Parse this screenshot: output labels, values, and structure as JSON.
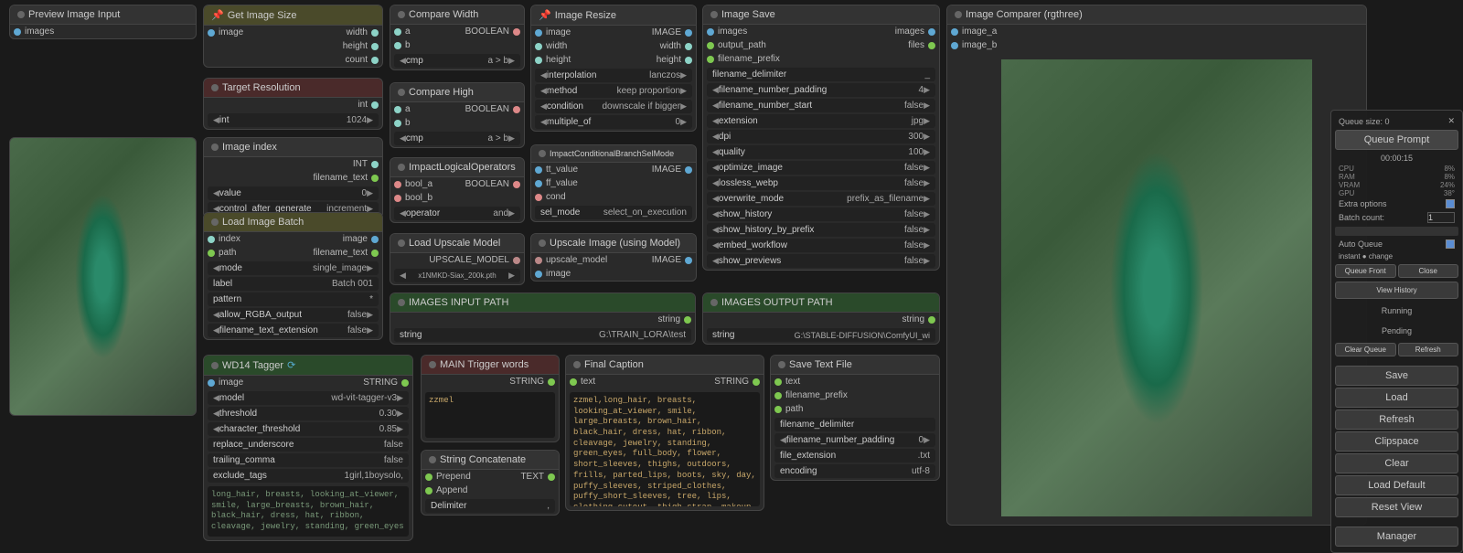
{
  "nodes": {
    "preview_input": {
      "title": "Preview Image Input",
      "outputs": [
        "images"
      ]
    },
    "get_size": {
      "title": "Get Image Size",
      "inputs": [
        "image"
      ],
      "outputs": [
        "width",
        "height",
        "count"
      ]
    },
    "target_res": {
      "title": "Target Resolution",
      "outputs": [
        "int"
      ],
      "int_val": "1024"
    },
    "image_index": {
      "title": "Image index",
      "outputs": [
        "INT",
        "filename_text"
      ],
      "value": "0",
      "ctrl": "increment"
    },
    "load_batch": {
      "title": "Load Image Batch",
      "out_image": "image",
      "out_ft": "filename_text",
      "in_index": "index",
      "in_path": "path",
      "mode": "single_image",
      "label": "Batch 001",
      "pattern": "*",
      "rgba": "false",
      "fte": "false"
    },
    "wd14": {
      "title": "WD14 Tagger",
      "in_image": "image",
      "out_str": "STRING",
      "model": "wd-vit-tagger-v3",
      "thresh": "0.30",
      "char": "0.85",
      "ru": "false",
      "tc": "false",
      "et": "1girl,1boysolo,",
      "caption": "long_hair, breasts, looking_at_viewer, smile, large_breasts, brown_hair, black_hair, dress, hat, ribbon, cleavage, jewelry, standing, green_eyes"
    },
    "compare_w": {
      "title": "Compare Width",
      "a": "a",
      "b": "b",
      "out": "BOOLEAN",
      "cmp": "a > b"
    },
    "compare_h": {
      "title": "Compare High",
      "a": "a",
      "b": "b",
      "out": "BOOLEAN",
      "cmp": "a > b"
    },
    "logic": {
      "title": "ImpactLogicalOperators",
      "a": "bool_a",
      "b": "bool_b",
      "out": "BOOLEAN",
      "op": "and"
    },
    "load_upscale": {
      "title": "Load Upscale Model",
      "out": "UPSCALE_MODEL",
      "model": "x1NMKD-Siax_200k.pth"
    },
    "images_input": {
      "title": "IMAGES INPUT PATH",
      "out": "string",
      "val": "G:\\TRAIN_LORA\\test"
    },
    "main_trigger": {
      "title": "MAIN Trigger words",
      "out": "STRING",
      "val": "zzmel"
    },
    "str_concat": {
      "title": "String Concatenate",
      "in1": "Prepend",
      "in2": "Append",
      "out": "TEXT",
      "delim": ","
    },
    "resize": {
      "title": "Image Resize",
      "in_image": "image",
      "in_width": "width",
      "in_height": "height",
      "out": "IMAGE",
      "interp": "lanczos",
      "method": "keep proportion",
      "cond": "downscale if bigger",
      "mult": "0"
    },
    "branch": {
      "title": "ImpactConditionalBranchSelMode",
      "tt": "tt_value",
      "ff": "ff_value",
      "cond": "cond",
      "out": "IMAGE",
      "sel": "select_on_execution"
    },
    "upscale_img": {
      "title": "Upscale Image (using Model)",
      "in_model": "upscale_model",
      "in_image": "image",
      "out": "IMAGE"
    },
    "final_caption": {
      "title": "Final Caption",
      "in": "text",
      "out": "STRING",
      "text": "zzmel,long_hair, breasts, looking_at_viewer, smile, large_breasts, brown_hair, black_hair, dress, hat, ribbon, cleavage, jewelry, standing, green_eyes, full_body, flower, short_sleeves, thighs, outdoors, frills, parted_lips, boots, sky, day, puffy_sleeves, striped_clothes, puffy_short_sleeves, tree, lips, clothing_cutout, thigh_strap, makeup, cleavage_cutout, sunlight, knee_boots, building, cross-laced_footwear, green_dress, top_hat, green_headwear, skirt_hold, hat_flower, red_lips, thighlet, dappled_sunlight, green_footwear, barrel"
    },
    "save": {
      "title": "Image Save",
      "in_images": "images",
      "in_path": "output_path",
      "in_prefix": "filename_prefix",
      "out_images": "images",
      "out_files": "files",
      "delim": "_",
      "pad": "4",
      "numstart": "false",
      "ext": "jpg",
      "dpi": "300",
      "quality": "100",
      "opt": "false",
      "webp": "false",
      "overwrite": "prefix_as_filename",
      "hist": "false",
      "histp": "false",
      "embed": "false",
      "prev": "false"
    },
    "images_output": {
      "title": "IMAGES OUTPUT PATH",
      "out": "string",
      "val": "G:\\STABLE-DIFFUSION\\ComfyUI_wi"
    },
    "save_text": {
      "title": "Save Text File",
      "in_text": "text",
      "in_prefix": "filename_prefix",
      "in_path": "path",
      "delim": "filename_delimiter",
      "pad": "0",
      "ext": ".txt",
      "enc": "utf-8"
    },
    "comparer": {
      "title": "Image Comparer (rgthree)",
      "a": "image_a",
      "b": "image_b"
    }
  },
  "sidebar": {
    "queue_size": "Queue size: 0",
    "queue_prompt": "Queue Prompt",
    "time": "00:00:15",
    "cpu": "CPU",
    "cpu_v": "8%",
    "ram": "RAM",
    "ram_v": "8%",
    "vram": "VRAM",
    "vram_v": "24%",
    "gpu": "GPU",
    "gpu_v": "38°",
    "extra": "Extra options",
    "batch": "Batch count:",
    "batch_v": "1",
    "auto": "Auto Queue",
    "instant": "instant",
    "change": "change",
    "qf": "Queue Front",
    "close": "Close",
    "vh": "View History",
    "running": "Running",
    "pending": "Pending",
    "clear_q": "Clear Queue",
    "refresh_q": "Refresh",
    "save": "Save",
    "load": "Load",
    "refresh": "Refresh",
    "clipspace": "Clipspace",
    "clear": "Clear",
    "load_def": "Load Default",
    "reset": "Reset View",
    "manager": "Manager"
  }
}
